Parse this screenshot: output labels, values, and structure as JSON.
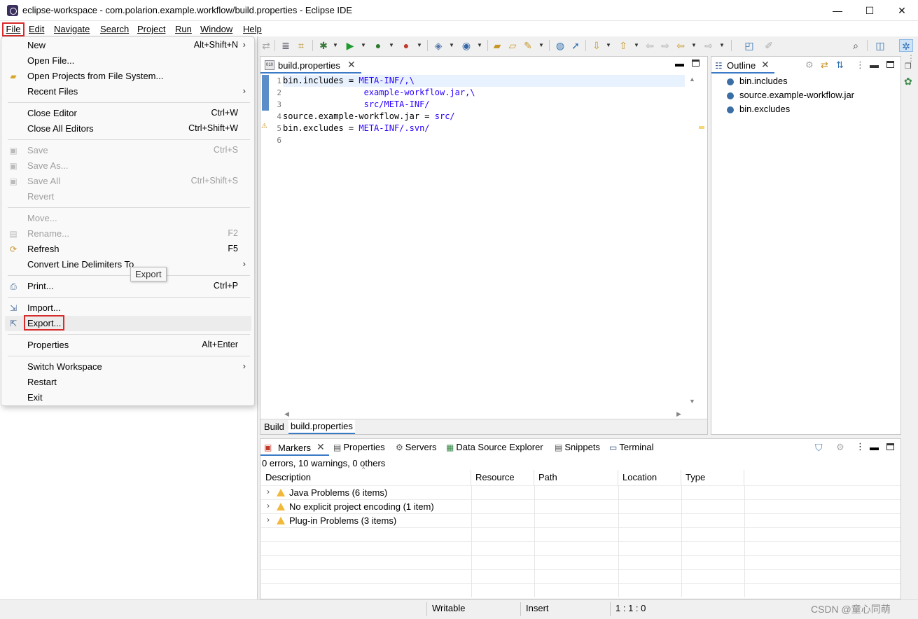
{
  "window": {
    "title": "eclipse-workspace - com.polarion.example.workflow/build.properties - Eclipse IDE",
    "minimize": "—",
    "maximize": "☐",
    "close": "✕"
  },
  "menubar": [
    "File",
    "Edit",
    "Navigate",
    "Search",
    "Project",
    "Run",
    "Window",
    "Help"
  ],
  "file_menu": {
    "new": {
      "label": "New",
      "shortcut": "Alt+Shift+N"
    },
    "open_file": {
      "label": "Open File..."
    },
    "open_projects": {
      "label": "Open Projects from File System..."
    },
    "recent_files": {
      "label": "Recent Files"
    },
    "close_editor": {
      "label": "Close Editor",
      "shortcut": "Ctrl+W"
    },
    "close_all": {
      "label": "Close All Editors",
      "shortcut": "Ctrl+Shift+W"
    },
    "save": {
      "label": "Save",
      "shortcut": "Ctrl+S"
    },
    "save_as": {
      "label": "Save As..."
    },
    "save_all": {
      "label": "Save All",
      "shortcut": "Ctrl+Shift+S"
    },
    "revert": {
      "label": "Revert"
    },
    "move": {
      "label": "Move..."
    },
    "rename": {
      "label": "Rename...",
      "shortcut": "F2"
    },
    "refresh": {
      "label": "Refresh",
      "shortcut": "F5"
    },
    "convert": {
      "label": "Convert Line Delimiters To"
    },
    "print": {
      "label": "Print...",
      "shortcut": "Ctrl+P"
    },
    "import": {
      "label": "Import..."
    },
    "export": {
      "label": "Export..."
    },
    "properties": {
      "label": "Properties",
      "shortcut": "Alt+Enter"
    },
    "switch_ws": {
      "label": "Switch Workspace"
    },
    "restart": {
      "label": "Restart"
    },
    "exit": {
      "label": "Exit"
    },
    "submenu_arrow": "›"
  },
  "tooltip": "Export",
  "editor": {
    "tab_label": "build.properties",
    "tab_icon": "010",
    "line_numbers": [
      "1",
      "2",
      "3",
      "4",
      "5",
      "6"
    ],
    "lines": [
      {
        "key": "bin.includes = ",
        "value": "META-INF/,\\"
      },
      {
        "key": "                ",
        "value": "example-workflow.jar,\\"
      },
      {
        "key": "                ",
        "value": "src/META-INF/"
      },
      {
        "key": "source.example-workflow.jar = ",
        "value": "src/"
      },
      {
        "key": "bin.excludes = ",
        "value": "META-INF/.svn/"
      },
      {
        "key": "",
        "value": ""
      }
    ],
    "bottom_tabs": [
      "Build",
      "build.properties"
    ]
  },
  "outline": {
    "tab_label": "Outline",
    "items": [
      "bin.includes",
      "source.example-workflow.jar",
      "bin.excludes"
    ]
  },
  "markers": {
    "tabs": [
      "Markers",
      "Properties",
      "Servers",
      "Data Source Explorer",
      "Snippets",
      "Terminal"
    ],
    "summary": "0 errors, 10 warnings, 0 others",
    "columns": [
      "Description",
      "Resource",
      "Path",
      "Location",
      "Type"
    ],
    "rows": [
      "Java Problems (6 items)",
      "No explicit project encoding (1 item)",
      "Plug-in Problems (3 items)"
    ]
  },
  "statusbar": {
    "writable": "Writable",
    "insert": "Insert",
    "position": "1 : 1 : 0",
    "watermark": "CSDN @童心同萌"
  },
  "colors": {
    "accent": "#3b7ac6",
    "highlight_box": "#d92b2b",
    "string_value": "#2a00ff"
  }
}
